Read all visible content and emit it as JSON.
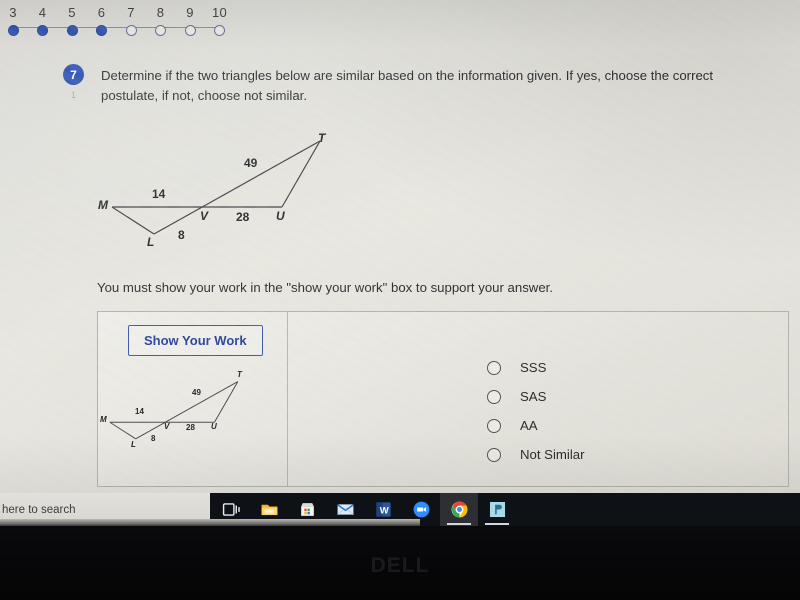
{
  "progress": {
    "steps": [
      {
        "number": "3",
        "state": "done"
      },
      {
        "number": "4",
        "state": "done"
      },
      {
        "number": "5",
        "state": "done"
      },
      {
        "number": "6",
        "state": "done"
      },
      {
        "number": "7",
        "state": "todo"
      },
      {
        "number": "8",
        "state": "todo"
      },
      {
        "number": "9",
        "state": "todo"
      },
      {
        "number": "10",
        "state": "todo"
      }
    ]
  },
  "question": {
    "badge_number": "7",
    "sub_number": "1",
    "text": "Determine if the two triangles below are similar based on the information given.  If  yes, choose the correct postulate, if not, choose not similar.",
    "instruction": "You must show your work in the \"show your work\" box to support your answer."
  },
  "figure": {
    "vertices": [
      {
        "label": "M"
      },
      {
        "label": "L"
      },
      {
        "label": "V"
      },
      {
        "label": "U"
      },
      {
        "label": "T"
      }
    ],
    "side_lengths": [
      {
        "value": "14",
        "segment": "MV"
      },
      {
        "value": "8",
        "segment": "LV"
      },
      {
        "value": "28",
        "segment": "VU"
      },
      {
        "value": "49",
        "segment": "VT"
      }
    ]
  },
  "panel": {
    "show_work_button": "Show Your Work",
    "options": [
      {
        "label": "SSS",
        "selected": false
      },
      {
        "label": "SAS",
        "selected": false
      },
      {
        "label": "AA",
        "selected": false
      },
      {
        "label": "Not Similar",
        "selected": false
      }
    ]
  },
  "taskbar": {
    "search_text": "here to search",
    "icons": [
      {
        "name": "task-view-icon",
        "state": "idle"
      },
      {
        "name": "file-explorer-icon",
        "state": "idle"
      },
      {
        "name": "microsoft-store-icon",
        "state": "idle"
      },
      {
        "name": "mail-icon",
        "state": "idle"
      },
      {
        "name": "word-icon",
        "state": "open"
      },
      {
        "name": "zoom-icon",
        "state": "idle"
      },
      {
        "name": "chrome-icon",
        "state": "active"
      },
      {
        "name": "app-icon",
        "state": "open"
      }
    ]
  },
  "bezel": {
    "brand": "DELL"
  },
  "colors": {
    "accent_blue": "#2b50b2",
    "step_done": "#2b4fb0",
    "button_blue": "#3f58ac",
    "taskbar": "#0e1116"
  }
}
